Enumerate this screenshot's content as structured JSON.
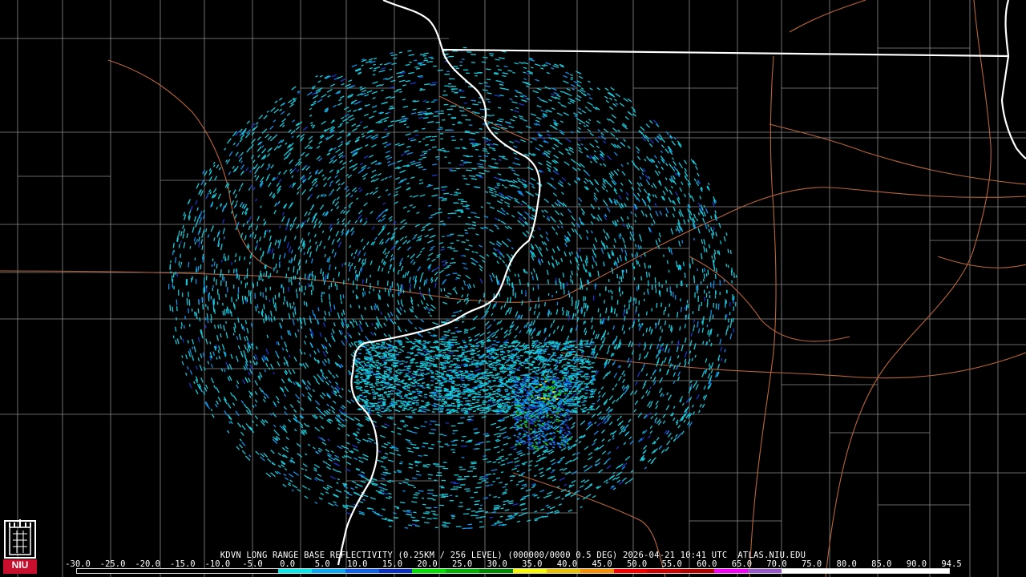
{
  "caption": "KDVN LONG RANGE BASE REFLECTIVITY (0.25KM / 256 LEVEL) (000000/0000 0.5 DEG) 2026-04-21 10:41 UTC  ATLAS.NIU.EDU",
  "logo_text": "NIU",
  "scale": {
    "labels": [
      "-30.0",
      "-25.0",
      "-20.0",
      "-15.0",
      "-10.0",
      "-5.0",
      "0.0",
      "5.0",
      "10.0",
      "15.0",
      "20.0",
      "25.0",
      "30.0",
      "35.0",
      "40.0",
      "45.0",
      "50.0",
      "55.0",
      "60.0",
      "65.0",
      "70.0",
      "75.0",
      "80.0",
      "85.0",
      "90.0",
      "94.5"
    ],
    "colors": [
      "#000000",
      "#000000",
      "#000000",
      "#000000",
      "#000000",
      "#000000",
      "#08e8e8",
      "#0aa8f0",
      "#1060e8",
      "#0a30c0",
      "#00e000",
      "#00b000",
      "#008800",
      "#f8f800",
      "#e8c000",
      "#f89000",
      "#f80000",
      "#d00000",
      "#b00000",
      "#f800f8",
      "#9858c8",
      "#ffffff",
      "#ffffff",
      "#ffffff",
      "#ffffff",
      "#ffffff"
    ]
  },
  "colors": {
    "state_border": "#ffffff",
    "county_line": "#8a8a8a",
    "highway": "#b8653a",
    "echo_light": "#18c8d8",
    "echo_mid": "#1090e8",
    "echo_blue": "#1838c8",
    "echo_green": "#20c020",
    "echo_yellow": "#e8e000"
  }
}
